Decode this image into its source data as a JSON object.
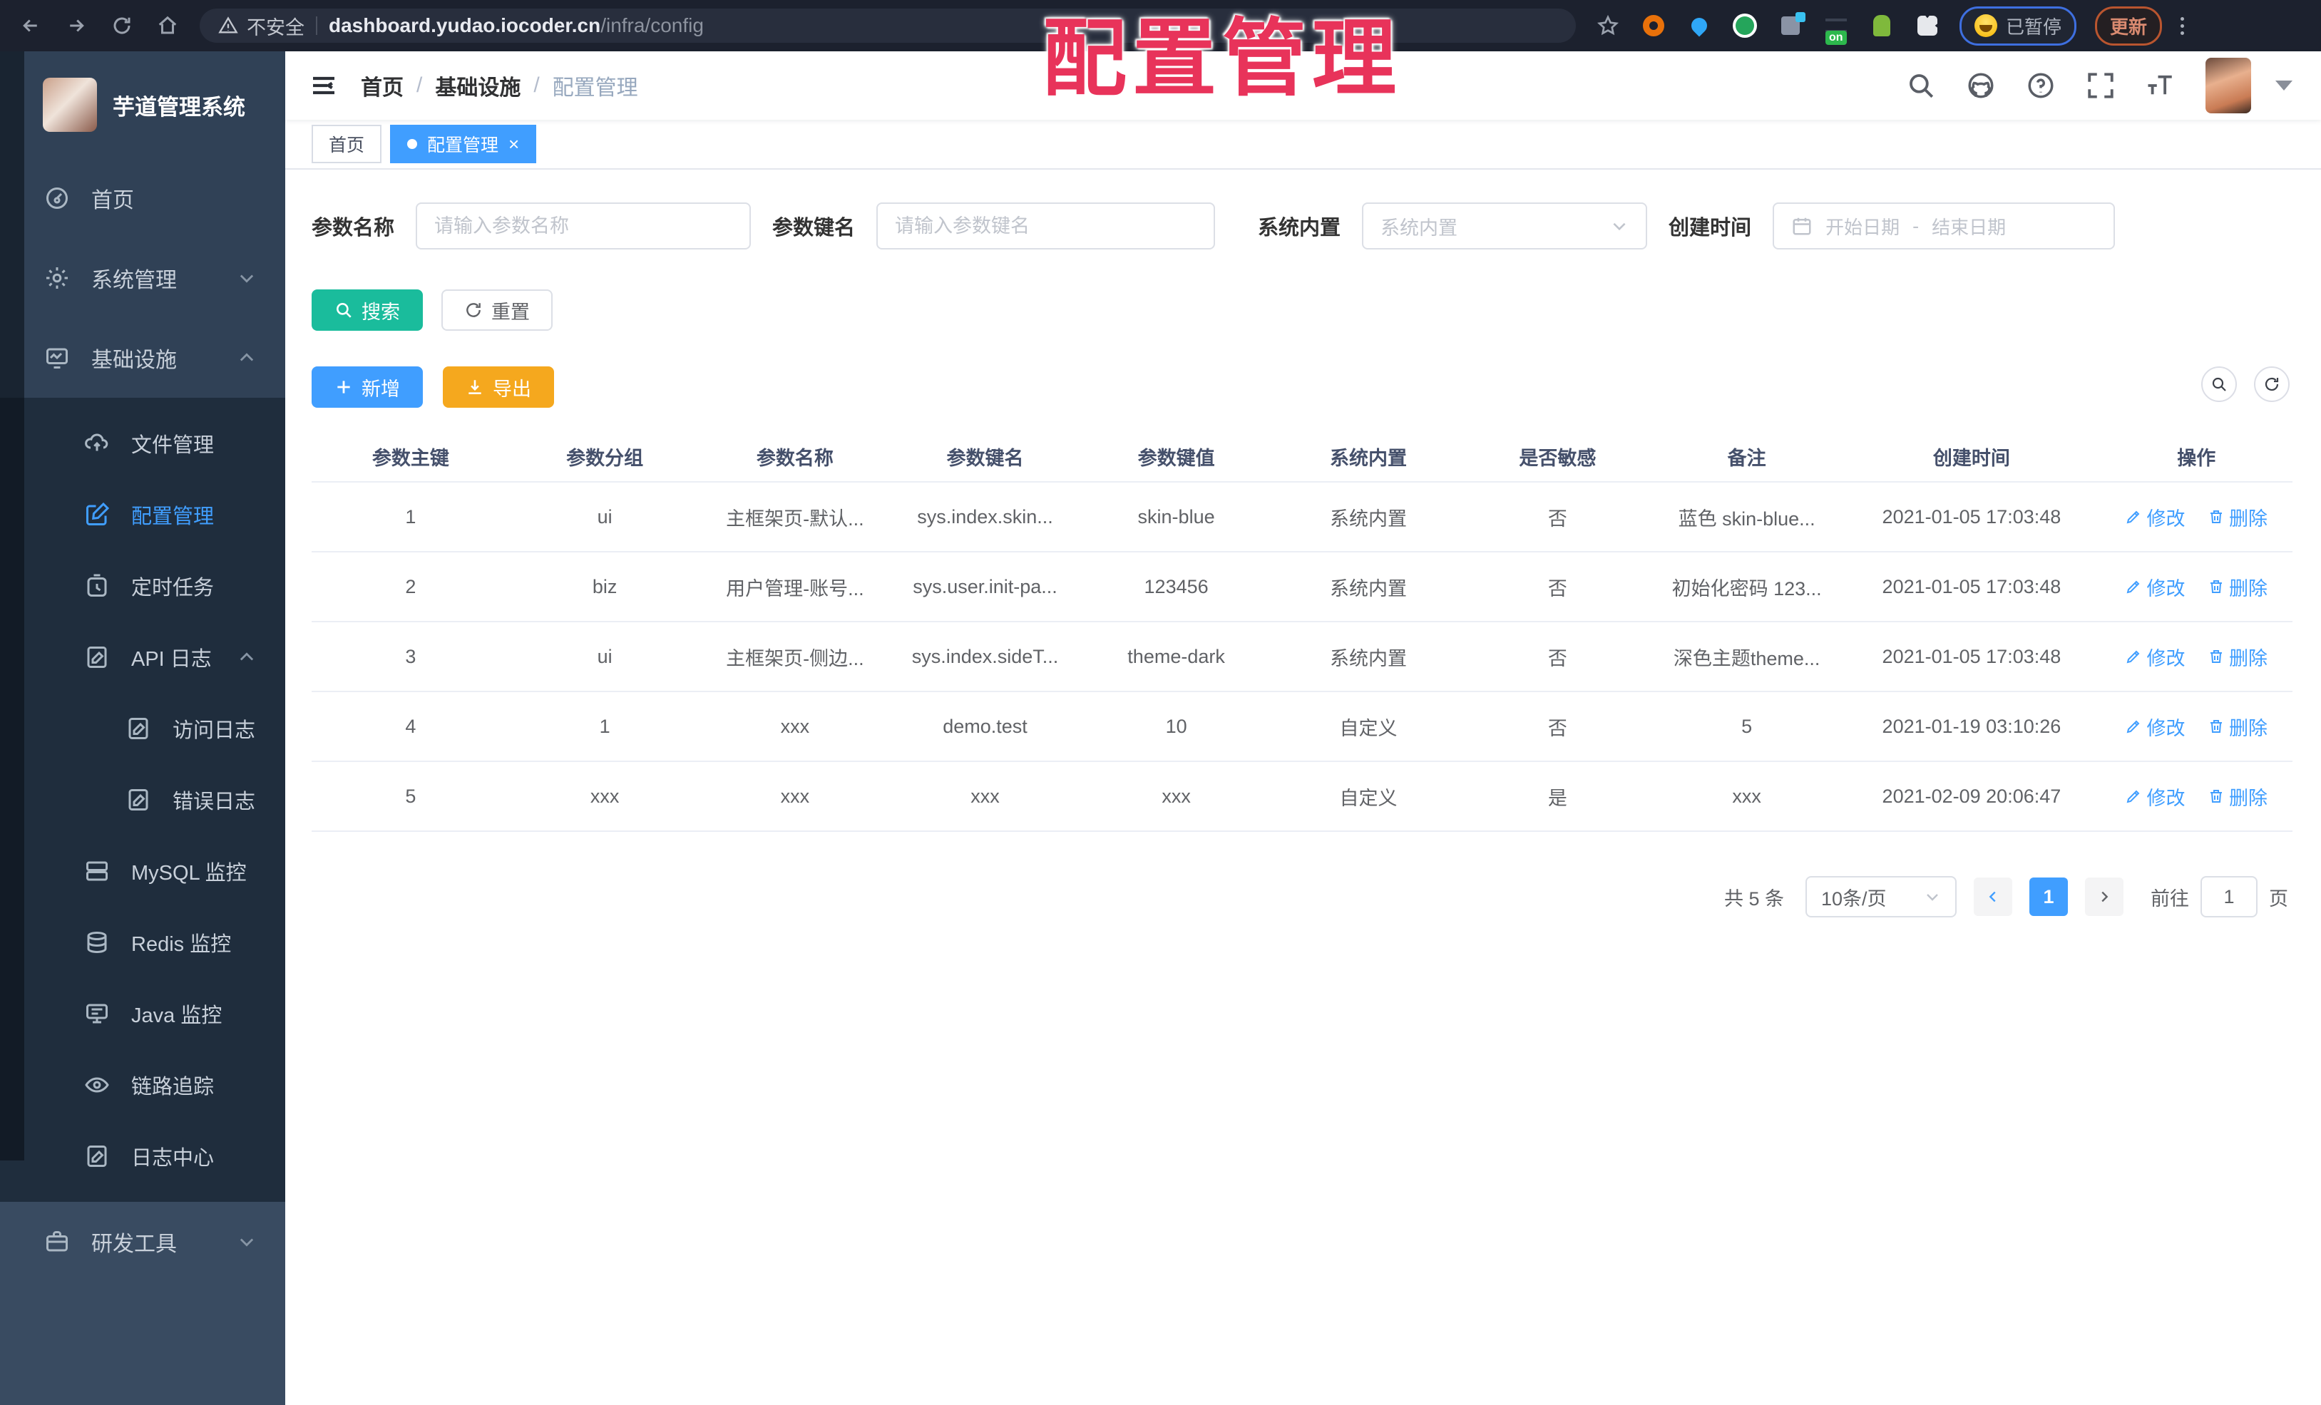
{
  "browser": {
    "security_label": "不安全",
    "url_host": "dashboard.yudao.iocoder.cn",
    "url_path": "/infra/config",
    "extension_on_badge": "on",
    "paused_badge": "已暂停",
    "update_button": "更新"
  },
  "overlay_title": "配置管理",
  "sidebar": {
    "logo_text": "芋道管理系统",
    "items": [
      {
        "label": "首页",
        "icon": "home-icon"
      },
      {
        "label": "系统管理",
        "icon": "gear-icon"
      },
      {
        "label": "基础设施",
        "icon": "infra-monitor-icon"
      },
      {
        "label": "文件管理",
        "icon": "cloud-upload-icon"
      },
      {
        "label": "配置管理",
        "icon": "edit-square-icon"
      },
      {
        "label": "定时任务",
        "icon": "timer-icon"
      },
      {
        "label": "API 日志",
        "icon": "doc-edit-icon"
      },
      {
        "label": "访问日志",
        "icon": "doc-edit-icon"
      },
      {
        "label": "错误日志",
        "icon": "doc-edit-icon"
      },
      {
        "label": "MySQL 监控",
        "icon": "database-icon"
      },
      {
        "label": "Redis 监控",
        "icon": "stack-icon"
      },
      {
        "label": "Java 监控",
        "icon": "java-monitor-icon"
      },
      {
        "label": "链路追踪",
        "icon": "eye-icon"
      },
      {
        "label": "日志中心",
        "icon": "doc-edit-icon"
      },
      {
        "label": "研发工具",
        "icon": "briefcase-icon"
      }
    ]
  },
  "header": {
    "breadcrumb": [
      "首页",
      "基础设施",
      "配置管理"
    ],
    "separator": "/"
  },
  "tabs": [
    {
      "label": "首页"
    },
    {
      "label": "配置管理"
    }
  ],
  "filters": {
    "name_label": "参数名称",
    "name_placeholder": "请输入参数名称",
    "key_label": "参数键名",
    "key_placeholder": "请输入参数键名",
    "builtin_label": "系统内置",
    "builtin_placeholder": "系统内置",
    "created_label": "创建时间",
    "date_start_placeholder": "开始日期",
    "date_separator": "-",
    "date_end_placeholder": "结束日期",
    "search_button": "搜索",
    "reset_button": "重置"
  },
  "toolbar": {
    "add_button": "新增",
    "export_button": "导出"
  },
  "table": {
    "columns": [
      "参数主键",
      "参数分组",
      "参数名称",
      "参数键名",
      "参数键值",
      "系统内置",
      "是否敏感",
      "备注",
      "创建时间",
      "操作"
    ],
    "edit_label": "修改",
    "delete_label": "删除",
    "rows": [
      {
        "id": "1",
        "group": "ui",
        "name": "主框架页-默认...",
        "key": "sys.index.skin...",
        "value": "skin-blue",
        "builtin": "系统内置",
        "sensitive": "否",
        "remark": "蓝色 skin-blue...",
        "created": "2021-01-05 17:03:48"
      },
      {
        "id": "2",
        "group": "biz",
        "name": "用户管理-账号...",
        "key": "sys.user.init-pa...",
        "value": "123456",
        "builtin": "系统内置",
        "sensitive": "否",
        "remark": "初始化密码 123...",
        "created": "2021-01-05 17:03:48"
      },
      {
        "id": "3",
        "group": "ui",
        "name": "主框架页-侧边...",
        "key": "sys.index.sideT...",
        "value": "theme-dark",
        "builtin": "系统内置",
        "sensitive": "否",
        "remark": "深色主题theme...",
        "created": "2021-01-05 17:03:48"
      },
      {
        "id": "4",
        "group": "1",
        "name": "xxx",
        "key": "demo.test",
        "value": "10",
        "builtin": "自定义",
        "sensitive": "否",
        "remark": "5",
        "created": "2021-01-19 03:10:26"
      },
      {
        "id": "5",
        "group": "xxx",
        "name": "xxx",
        "key": "xxx",
        "value": "xxx",
        "builtin": "自定义",
        "sensitive": "是",
        "remark": "xxx",
        "created": "2021-02-09 20:06:47"
      }
    ]
  },
  "pagination": {
    "total_text": "共 5 条",
    "page_size": "10条/页",
    "current_page": "1",
    "goto_label": "前往",
    "goto_value": "1",
    "page_unit": "页"
  },
  "colors": {
    "accent": "#409EFF",
    "search_button": "#1ABC9C",
    "export_button": "#F5A81E",
    "sidebar_bg": "#304156",
    "submenu_bg": "#1F2D3D",
    "overlay_title_red": "#E8335A"
  }
}
